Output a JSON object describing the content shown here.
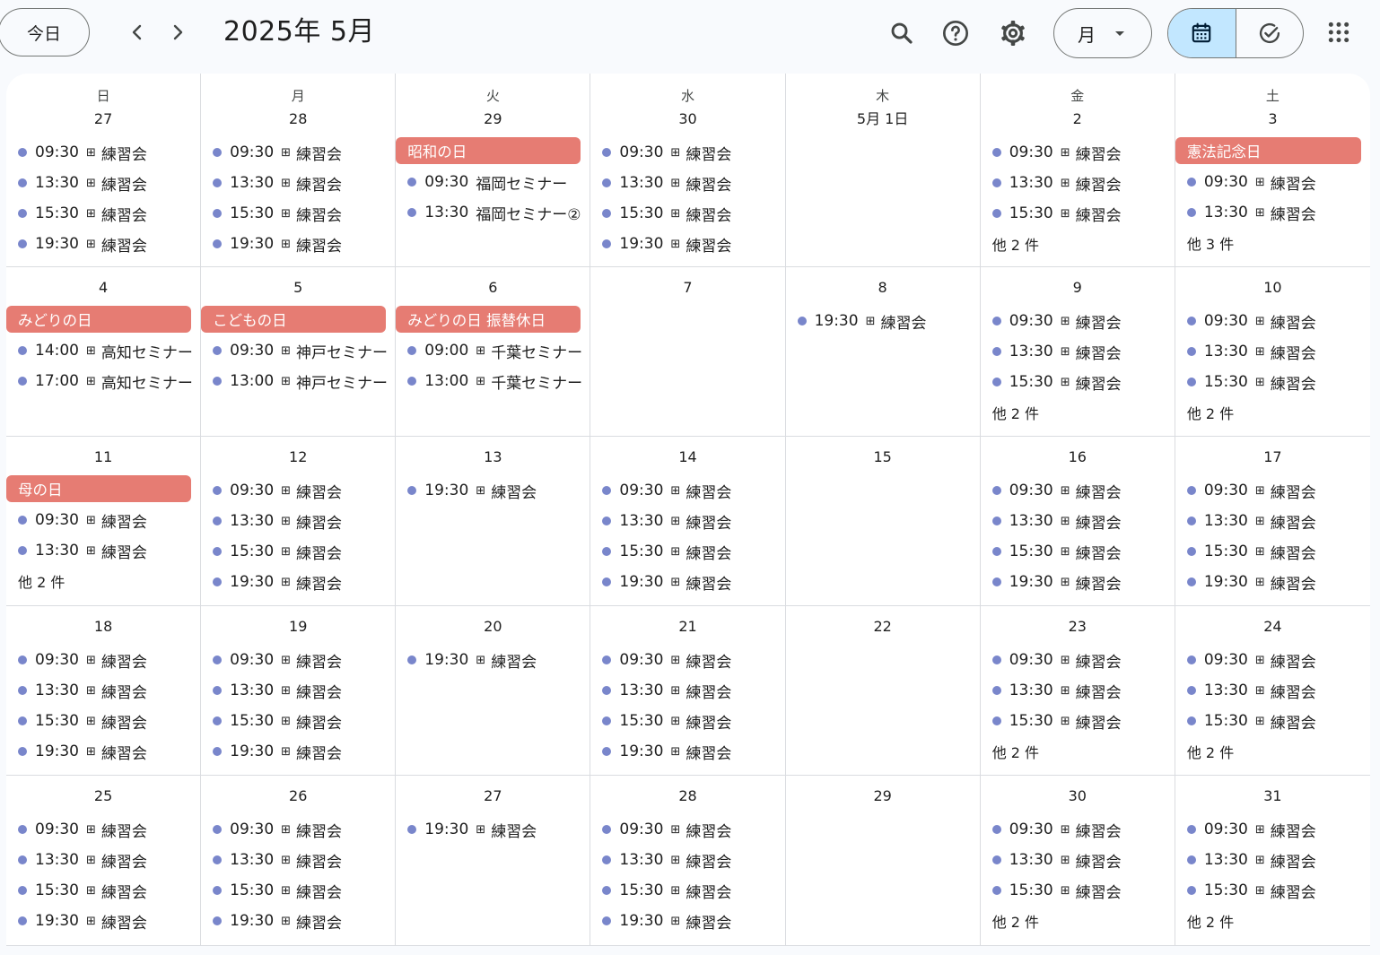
{
  "header": {
    "today_label": "今日",
    "month_title": "2025年 5月",
    "view_label": "月"
  },
  "weekdays": [
    "日",
    "月",
    "火",
    "水",
    "木",
    "金",
    "土"
  ],
  "colors": {
    "event_dot": "#7986cb",
    "holiday": "#e67c73",
    "selected": "#c2e7ff"
  },
  "weeks": [
    {
      "days": [
        {
          "day": "27",
          "events": [
            {
              "time": "09:30",
              "title": "練習会"
            },
            {
              "time": "13:30",
              "title": "練習会"
            },
            {
              "time": "15:30",
              "title": "練習会"
            },
            {
              "time": "19:30",
              "title": "練習会"
            }
          ]
        },
        {
          "day": "28",
          "events": [
            {
              "time": "09:30",
              "title": "練習会"
            },
            {
              "time": "13:30",
              "title": "練習会"
            },
            {
              "time": "15:30",
              "title": "練習会"
            },
            {
              "time": "19:30",
              "title": "練習会"
            }
          ]
        },
        {
          "day": "29",
          "allday": "昭和の日",
          "events": [
            {
              "time": "09:30",
              "title": "福岡セミナー",
              "noicon": true
            },
            {
              "time": "13:30",
              "title": "福岡セミナー②",
              "noicon": true
            }
          ]
        },
        {
          "day": "30",
          "events": [
            {
              "time": "09:30",
              "title": "練習会"
            },
            {
              "time": "13:30",
              "title": "練習会"
            },
            {
              "time": "15:30",
              "title": "練習会"
            },
            {
              "time": "19:30",
              "title": "練習会"
            }
          ]
        },
        {
          "day": "5月 1日",
          "events": []
        },
        {
          "day": "2",
          "events": [
            {
              "time": "09:30",
              "title": "練習会"
            },
            {
              "time": "13:30",
              "title": "練習会"
            },
            {
              "time": "15:30",
              "title": "練習会"
            }
          ],
          "more": "他 2 件"
        },
        {
          "day": "3",
          "allday": "憲法記念日",
          "events": [
            {
              "time": "09:30",
              "title": "練習会"
            },
            {
              "time": "13:30",
              "title": "練習会"
            }
          ],
          "more": "他 3 件"
        }
      ]
    },
    {
      "days": [
        {
          "day": "4",
          "allday": "みどりの日",
          "events": [
            {
              "time": "14:00",
              "title": "高知セミナー"
            },
            {
              "time": "17:00",
              "title": "高知セミナー"
            }
          ]
        },
        {
          "day": "5",
          "allday": "こどもの日",
          "events": [
            {
              "time": "09:30",
              "title": "神戸セミナー"
            },
            {
              "time": "13:00",
              "title": "神戸セミナー"
            }
          ]
        },
        {
          "day": "6",
          "allday": "みどりの日 振替休日",
          "events": [
            {
              "time": "09:00",
              "title": "千葉セミナー"
            },
            {
              "time": "13:00",
              "title": "千葉セミナー"
            }
          ]
        },
        {
          "day": "7",
          "events": []
        },
        {
          "day": "8",
          "events": [
            {
              "time": "19:30",
              "title": "練習会"
            }
          ]
        },
        {
          "day": "9",
          "events": [
            {
              "time": "09:30",
              "title": "練習会"
            },
            {
              "time": "13:30",
              "title": "練習会"
            },
            {
              "time": "15:30",
              "title": "練習会"
            }
          ],
          "more": "他 2 件"
        },
        {
          "day": "10",
          "events": [
            {
              "time": "09:30",
              "title": "練習会"
            },
            {
              "time": "13:30",
              "title": "練習会"
            },
            {
              "time": "15:30",
              "title": "練習会"
            }
          ],
          "more": "他 2 件"
        }
      ]
    },
    {
      "days": [
        {
          "day": "11",
          "allday": "母の日",
          "events": [
            {
              "time": "09:30",
              "title": "練習会"
            },
            {
              "time": "13:30",
              "title": "練習会"
            }
          ],
          "more": "他 2 件"
        },
        {
          "day": "12",
          "events": [
            {
              "time": "09:30",
              "title": "練習会"
            },
            {
              "time": "13:30",
              "title": "練習会"
            },
            {
              "time": "15:30",
              "title": "練習会"
            },
            {
              "time": "19:30",
              "title": "練習会"
            }
          ]
        },
        {
          "day": "13",
          "events": [
            {
              "time": "19:30",
              "title": "練習会"
            }
          ]
        },
        {
          "day": "14",
          "events": [
            {
              "time": "09:30",
              "title": "練習会"
            },
            {
              "time": "13:30",
              "title": "練習会"
            },
            {
              "time": "15:30",
              "title": "練習会"
            },
            {
              "time": "19:30",
              "title": "練習会"
            }
          ]
        },
        {
          "day": "15",
          "events": []
        },
        {
          "day": "16",
          "events": [
            {
              "time": "09:30",
              "title": "練習会"
            },
            {
              "time": "13:30",
              "title": "練習会"
            },
            {
              "time": "15:30",
              "title": "練習会"
            },
            {
              "time": "19:30",
              "title": "練習会"
            }
          ]
        },
        {
          "day": "17",
          "events": [
            {
              "time": "09:30",
              "title": "練習会"
            },
            {
              "time": "13:30",
              "title": "練習会"
            },
            {
              "time": "15:30",
              "title": "練習会"
            },
            {
              "time": "19:30",
              "title": "練習会"
            }
          ]
        }
      ]
    },
    {
      "days": [
        {
          "day": "18",
          "events": [
            {
              "time": "09:30",
              "title": "練習会"
            },
            {
              "time": "13:30",
              "title": "練習会"
            },
            {
              "time": "15:30",
              "title": "練習会"
            },
            {
              "time": "19:30",
              "title": "練習会"
            }
          ]
        },
        {
          "day": "19",
          "events": [
            {
              "time": "09:30",
              "title": "練習会"
            },
            {
              "time": "13:30",
              "title": "練習会"
            },
            {
              "time": "15:30",
              "title": "練習会"
            },
            {
              "time": "19:30",
              "title": "練習会"
            }
          ]
        },
        {
          "day": "20",
          "events": [
            {
              "time": "19:30",
              "title": "練習会"
            }
          ]
        },
        {
          "day": "21",
          "events": [
            {
              "time": "09:30",
              "title": "練習会"
            },
            {
              "time": "13:30",
              "title": "練習会"
            },
            {
              "time": "15:30",
              "title": "練習会"
            },
            {
              "time": "19:30",
              "title": "練習会"
            }
          ]
        },
        {
          "day": "22",
          "events": []
        },
        {
          "day": "23",
          "events": [
            {
              "time": "09:30",
              "title": "練習会"
            },
            {
              "time": "13:30",
              "title": "練習会"
            },
            {
              "time": "15:30",
              "title": "練習会"
            }
          ],
          "more": "他 2 件"
        },
        {
          "day": "24",
          "events": [
            {
              "time": "09:30",
              "title": "練習会"
            },
            {
              "time": "13:30",
              "title": "練習会"
            },
            {
              "time": "15:30",
              "title": "練習会"
            }
          ],
          "more": "他 2 件"
        }
      ]
    },
    {
      "days": [
        {
          "day": "25",
          "events": [
            {
              "time": "09:30",
              "title": "練習会"
            },
            {
              "time": "13:30",
              "title": "練習会"
            },
            {
              "time": "15:30",
              "title": "練習会"
            },
            {
              "time": "19:30",
              "title": "練習会"
            }
          ]
        },
        {
          "day": "26",
          "events": [
            {
              "time": "09:30",
              "title": "練習会"
            },
            {
              "time": "13:30",
              "title": "練習会"
            },
            {
              "time": "15:30",
              "title": "練習会"
            },
            {
              "time": "19:30",
              "title": "練習会"
            }
          ]
        },
        {
          "day": "27",
          "events": [
            {
              "time": "19:30",
              "title": "練習会"
            }
          ]
        },
        {
          "day": "28",
          "events": [
            {
              "time": "09:30",
              "title": "練習会"
            },
            {
              "time": "13:30",
              "title": "練習会"
            },
            {
              "time": "15:30",
              "title": "練習会"
            },
            {
              "time": "19:30",
              "title": "練習会"
            }
          ]
        },
        {
          "day": "29",
          "events": []
        },
        {
          "day": "30",
          "events": [
            {
              "time": "09:30",
              "title": "練習会"
            },
            {
              "time": "13:30",
              "title": "練習会"
            },
            {
              "time": "15:30",
              "title": "練習会"
            }
          ],
          "more": "他 2 件"
        },
        {
          "day": "31",
          "events": [
            {
              "time": "09:30",
              "title": "練習会"
            },
            {
              "time": "13:30",
              "title": "練習会"
            },
            {
              "time": "15:30",
              "title": "練習会"
            }
          ],
          "more": "他 2 件"
        }
      ]
    }
  ]
}
